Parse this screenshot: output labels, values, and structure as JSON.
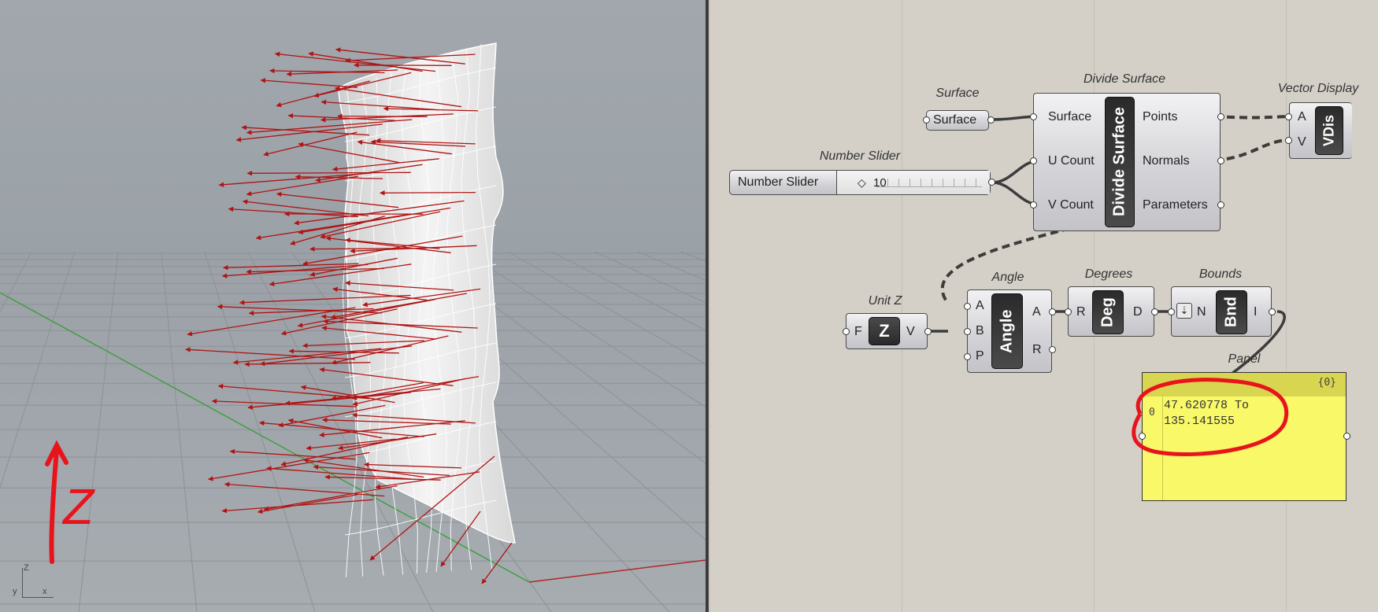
{
  "viewport": {
    "sketch_label": "Z",
    "axis_labels": {
      "z": "Z",
      "y": "y",
      "x": "x"
    }
  },
  "canvas": {
    "surface": {
      "label": "Surface",
      "button": "Surface"
    },
    "divide_surface": {
      "label": "Divide Surface",
      "nickname": "Divide Surface",
      "inputs": [
        "Surface",
        "U Count",
        "V Count"
      ],
      "outputs": [
        "Points",
        "Normals",
        "Parameters"
      ]
    },
    "vector_display": {
      "label": "Vector Display",
      "nickname": "VDis",
      "inputs": [
        "A",
        "V"
      ]
    },
    "number_slider": {
      "label": "Number Slider",
      "name": "Number Slider",
      "value": "10"
    },
    "unit_z": {
      "label": "Unit Z",
      "nickname": "Z",
      "input": "F",
      "output": "V"
    },
    "angle": {
      "label": "Angle",
      "nickname": "Angle",
      "inputs": [
        "A",
        "B",
        "P"
      ],
      "outputs": [
        "A",
        "R"
      ]
    },
    "degrees": {
      "label": "Degrees",
      "nickname": "Deg",
      "input": "R",
      "output": "D"
    },
    "bounds": {
      "label": "Bounds",
      "nickname": "Bnd",
      "input": "N",
      "output": "I"
    },
    "panel": {
      "label": "Panel",
      "path": "{0}",
      "index": "0",
      "text": "47.620778 To\n135.141555"
    }
  },
  "colors": {
    "wire": "#3c3c3c",
    "annotation": "#e8141c",
    "panel_fill": "#f8f868",
    "normal_vector": "#b01414",
    "x_axis": "#b02828",
    "y_axis": "#40a040"
  }
}
